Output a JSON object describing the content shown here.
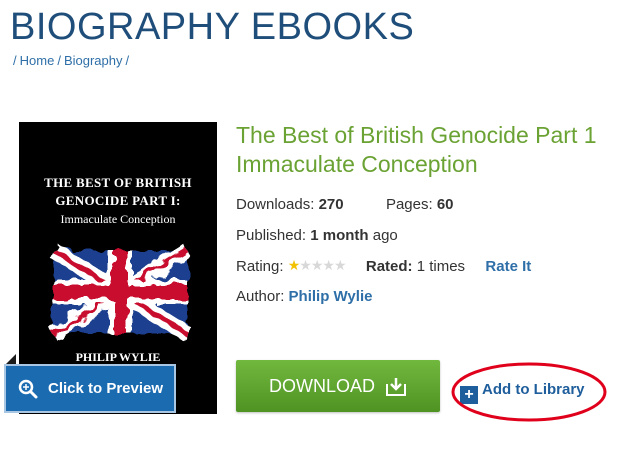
{
  "page": {
    "title": "BIOGRAPHY EBOOKS"
  },
  "breadcrumb": {
    "items": [
      "Home",
      "Biography"
    ]
  },
  "cover": {
    "title_line1": "THE BEST OF BRITISH",
    "title_line2": "GENOCIDE PART I:",
    "subtitle": "Immaculate Conception",
    "author": "PHILIP WYLIE"
  },
  "preview_button": {
    "label": "Click to Preview",
    "icon": "magnifier-icon"
  },
  "book": {
    "title_line1": "The Best of British Genocide Part 1",
    "title_line2": "Immaculate Conception",
    "downloads_label": "Downloads:",
    "downloads": "270",
    "pages_label": "Pages:",
    "pages": "60",
    "published_label": "Published:",
    "published": "1 month",
    "published_suffix": "ago",
    "rating_label": "Rating:",
    "rating_stars": 1,
    "rating_max": 5,
    "rated_label": "Rated:",
    "rated_count": "1 times",
    "rate_it": "Rate It",
    "author_label": "Author:",
    "author": "Philip Wylie"
  },
  "actions": {
    "download_label": "DOWNLOAD",
    "add_library_label": "Add to Library"
  },
  "colors": {
    "title": "#1f4e7a",
    "book_title": "#6aa233",
    "link": "#2f6fa8",
    "download": "#5fa52f",
    "annotation_circle": "#e0001b"
  }
}
